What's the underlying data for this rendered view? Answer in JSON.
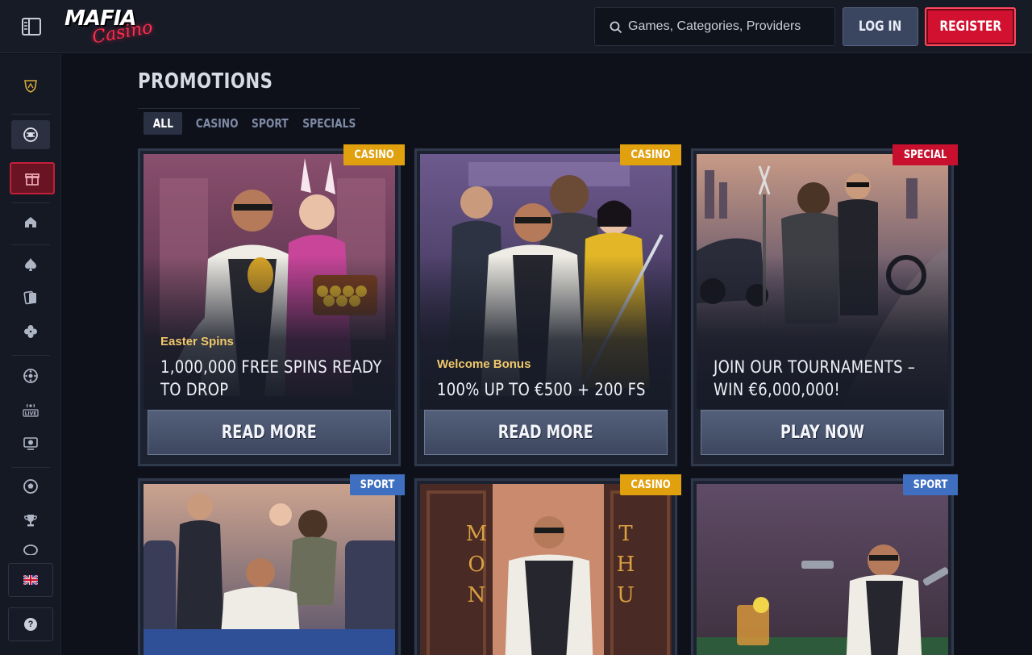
{
  "header": {
    "logo_top": "MAFIA",
    "logo_bottom": "Casino",
    "search_placeholder": "Games, Categories, Providers",
    "login_label": "LOG IN",
    "register_label": "REGISTER"
  },
  "sidebar": {
    "items": [
      {
        "name": "lamborghini-icon"
      },
      {
        "name": "vip-chip-icon"
      },
      {
        "name": "gift-icon"
      },
      {
        "name": "home-icon"
      },
      {
        "name": "spade-icon"
      },
      {
        "name": "cards-icon"
      },
      {
        "name": "clover-icon"
      },
      {
        "name": "roulette-icon"
      },
      {
        "name": "live-icon",
        "label": "LIVE"
      },
      {
        "name": "tv-game-icon"
      },
      {
        "name": "football-icon"
      },
      {
        "name": "trophy-icon"
      },
      {
        "name": "ball-icon"
      }
    ],
    "language_flag": "uk-flag-icon",
    "help_label": "?"
  },
  "main": {
    "title": "PROMOTIONS",
    "tabs": [
      {
        "label": "ALL",
        "active": true
      },
      {
        "label": "CASINO"
      },
      {
        "label": "SPORT"
      },
      {
        "label": "SPECIALS"
      }
    ],
    "cards": [
      {
        "badge": "CASINO",
        "badge_type": "casino",
        "subtitle": "Easter Spins",
        "title": "1,000,000 FREE SPINS READY TO DROP",
        "cta": "READ MORE"
      },
      {
        "badge": "CASINO",
        "badge_type": "casino",
        "subtitle": "Welcome Bonus",
        "title": "100% UP TO €500 + 200 FS",
        "cta": "READ MORE"
      },
      {
        "badge": "SPECIAL",
        "badge_type": "special",
        "subtitle": "",
        "title": "JOIN OUR TOURNAMENTS – WIN €6,000,000!",
        "cta": "PLAY NOW"
      },
      {
        "badge": "SPORT",
        "badge_type": "sport"
      },
      {
        "badge": "CASINO",
        "badge_type": "casino",
        "door_left": "MON",
        "door_right": "THU"
      },
      {
        "badge": "SPORT",
        "badge_type": "sport"
      }
    ]
  },
  "colors": {
    "background": "#0e1119",
    "accent_red": "#d1112f",
    "casino_badge": "#e1a00e",
    "sport_badge": "#3f6fc0",
    "special_badge": "#c8102e",
    "subtitle_gold": "#f1c86a"
  }
}
